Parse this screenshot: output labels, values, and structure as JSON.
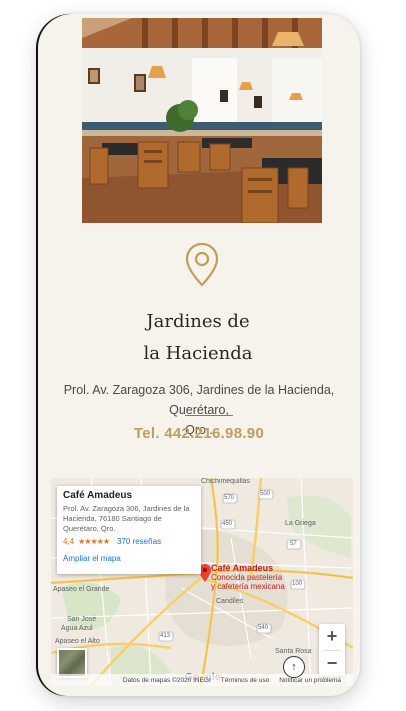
{
  "venue": {
    "name_line1": "Jardines de",
    "name_line2": "la Hacienda",
    "address_line1": "Prol. Av. Zaragoza 306, Jardines de la Hacienda, Querétaro,",
    "address_line2": "Qro..",
    "phone": "Tel. 442.216.98.90"
  },
  "map": {
    "card": {
      "title": "Café Amadeus",
      "address": "Prol. Av. Zaragoza 306, Jardines de la Hacienda, 76180 Santiago de Querétaro, Qro.",
      "rating": "4,4",
      "stars": "★★★★★",
      "reviews": "370 reseñas",
      "link": "Ampliar el mapa"
    },
    "marker_title": "Café Amadeus",
    "marker_sub1": "Conocida pastelería",
    "marker_sub2": "y cafetería mexicana",
    "places": {
      "chichimequillas": "Chichimequillas",
      "griega": "La Griega",
      "candiles": "Candiles",
      "apaseo_grande": "Apaseo el Grande",
      "san_jose": "San José",
      "agua_azul": "Agua Azul",
      "apaseo_alto": "Apaseo el Alto",
      "santa_rosa": "Santa Rosa",
      "road_570": "570",
      "road_450": "450",
      "road_57": "57",
      "road_413": "413",
      "road_500": "500",
      "road_540": "540",
      "road_100": "100"
    },
    "zoom_in": "+",
    "zoom_out": "−",
    "google": [
      "G",
      "o",
      "o",
      "g",
      "l",
      "e"
    ],
    "google_colors": [
      "#4285F4",
      "#EA4335",
      "#FBBC05",
      "#4285F4",
      "#34A853",
      "#EA4335"
    ],
    "attribution": {
      "data": "Datos de mapas ©2020 INEGI",
      "terms": "Términos de uso",
      "report": "Notificar un problema"
    }
  },
  "scroll_top": "↑",
  "colors": {
    "accent_gold": "#bf9d5c",
    "background": "#f6f2ec",
    "marker_red": "#c5221f"
  }
}
